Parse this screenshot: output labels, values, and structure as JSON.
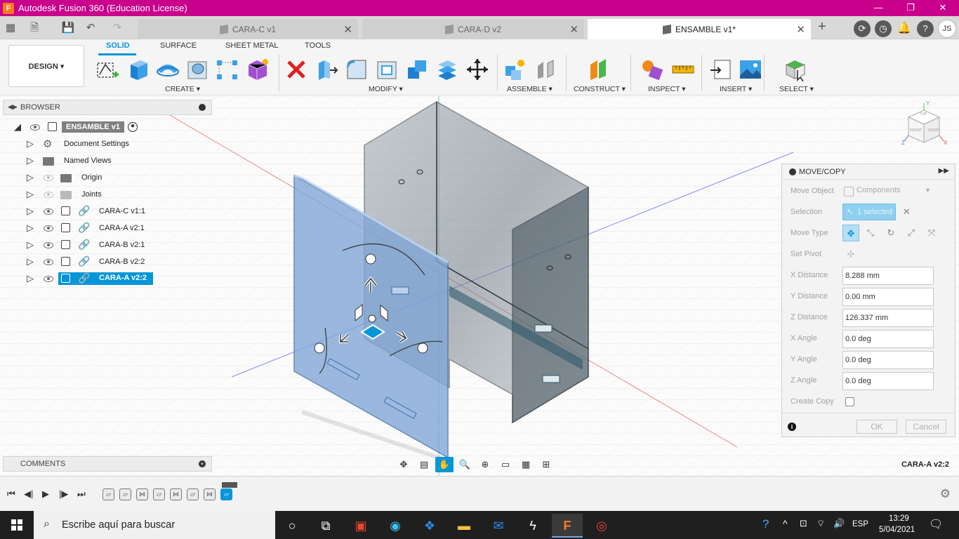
{
  "window": {
    "title": "Autodesk Fusion 360 (Education License)",
    "app_icon_letter": "F",
    "minimize": "—",
    "restore": "❐",
    "close": "✕"
  },
  "tabs": [
    {
      "label": "CARA-C v1",
      "active": false
    },
    {
      "label": "CARA-D v2",
      "active": false
    },
    {
      "label": "ENSAMBLE v1*",
      "active": true
    }
  ],
  "tab_close": "✕",
  "new_tab": "+",
  "user_initials": "JS",
  "toolbar": {
    "design_button": "DESIGN ▾",
    "workspace_tabs": [
      "SOLID",
      "SURFACE",
      "SHEET METAL",
      "TOOLS"
    ],
    "groups": [
      "CREATE ▾",
      "MODIFY ▾",
      "ASSEMBLE ▾",
      "CONSTRUCT ▾",
      "INSPECT ▾",
      "INSERT ▾",
      "SELECT ▾"
    ]
  },
  "browser": {
    "header": "BROWSER",
    "root": "ENSAMBLE v1",
    "items": [
      {
        "label": "Document Settings",
        "icon": "gear-icon"
      },
      {
        "label": "Named Views",
        "icon": "folder-icon"
      },
      {
        "label": "Origin",
        "icon": "folder-icon"
      },
      {
        "label": "Joints",
        "icon": "folder-icon"
      },
      {
        "label": "CARA-C v1:1",
        "icon": "component-icon"
      },
      {
        "label": "CARA-A v2:1",
        "icon": "component-icon"
      },
      {
        "label": "CARA-B v2:1",
        "icon": "component-icon"
      },
      {
        "label": "CARA-B v2:2",
        "icon": "component-icon"
      },
      {
        "label": "CARA-A v2:2",
        "icon": "component-icon",
        "selected": true
      }
    ]
  },
  "comments": {
    "header": "COMMENTS"
  },
  "viewcube": {
    "top": "TOP",
    "front": "FRONT",
    "right": "RIGHT",
    "axis_z": "Z",
    "axis_x": "X",
    "axis_y": "Y"
  },
  "move_copy": {
    "title": "MOVE/COPY",
    "move_object_label": "Move Object",
    "move_object_value": "Components",
    "selection_label": "Selection",
    "selection_value": "1 selected",
    "move_type_label": "Move Type",
    "set_pivot_label": "Set Pivot",
    "fields": [
      {
        "label": "X Distance",
        "value": "8.288 mm"
      },
      {
        "label": "Y Distance",
        "value": "0.00 mm"
      },
      {
        "label": "Z Distance",
        "value": "126.337 mm"
      },
      {
        "label": "X Angle",
        "value": "0.0 deg"
      },
      {
        "label": "Y Angle",
        "value": "0.0 deg"
      },
      {
        "label": "Z Angle",
        "value": "0.0 deg"
      }
    ],
    "create_copy_label": "Create Copy",
    "ok": "OK",
    "cancel": "Cancel"
  },
  "status": {
    "selected_component": "CARA-A v2:2"
  },
  "taskbar": {
    "search_placeholder": "Escribe aquí para buscar",
    "language": "ESP",
    "time": "13:29",
    "date": "5/04/2021"
  },
  "colors": {
    "accent": "#0696d7",
    "titlebar": "#c8008c",
    "panel_blue": "#7fa6d6"
  }
}
